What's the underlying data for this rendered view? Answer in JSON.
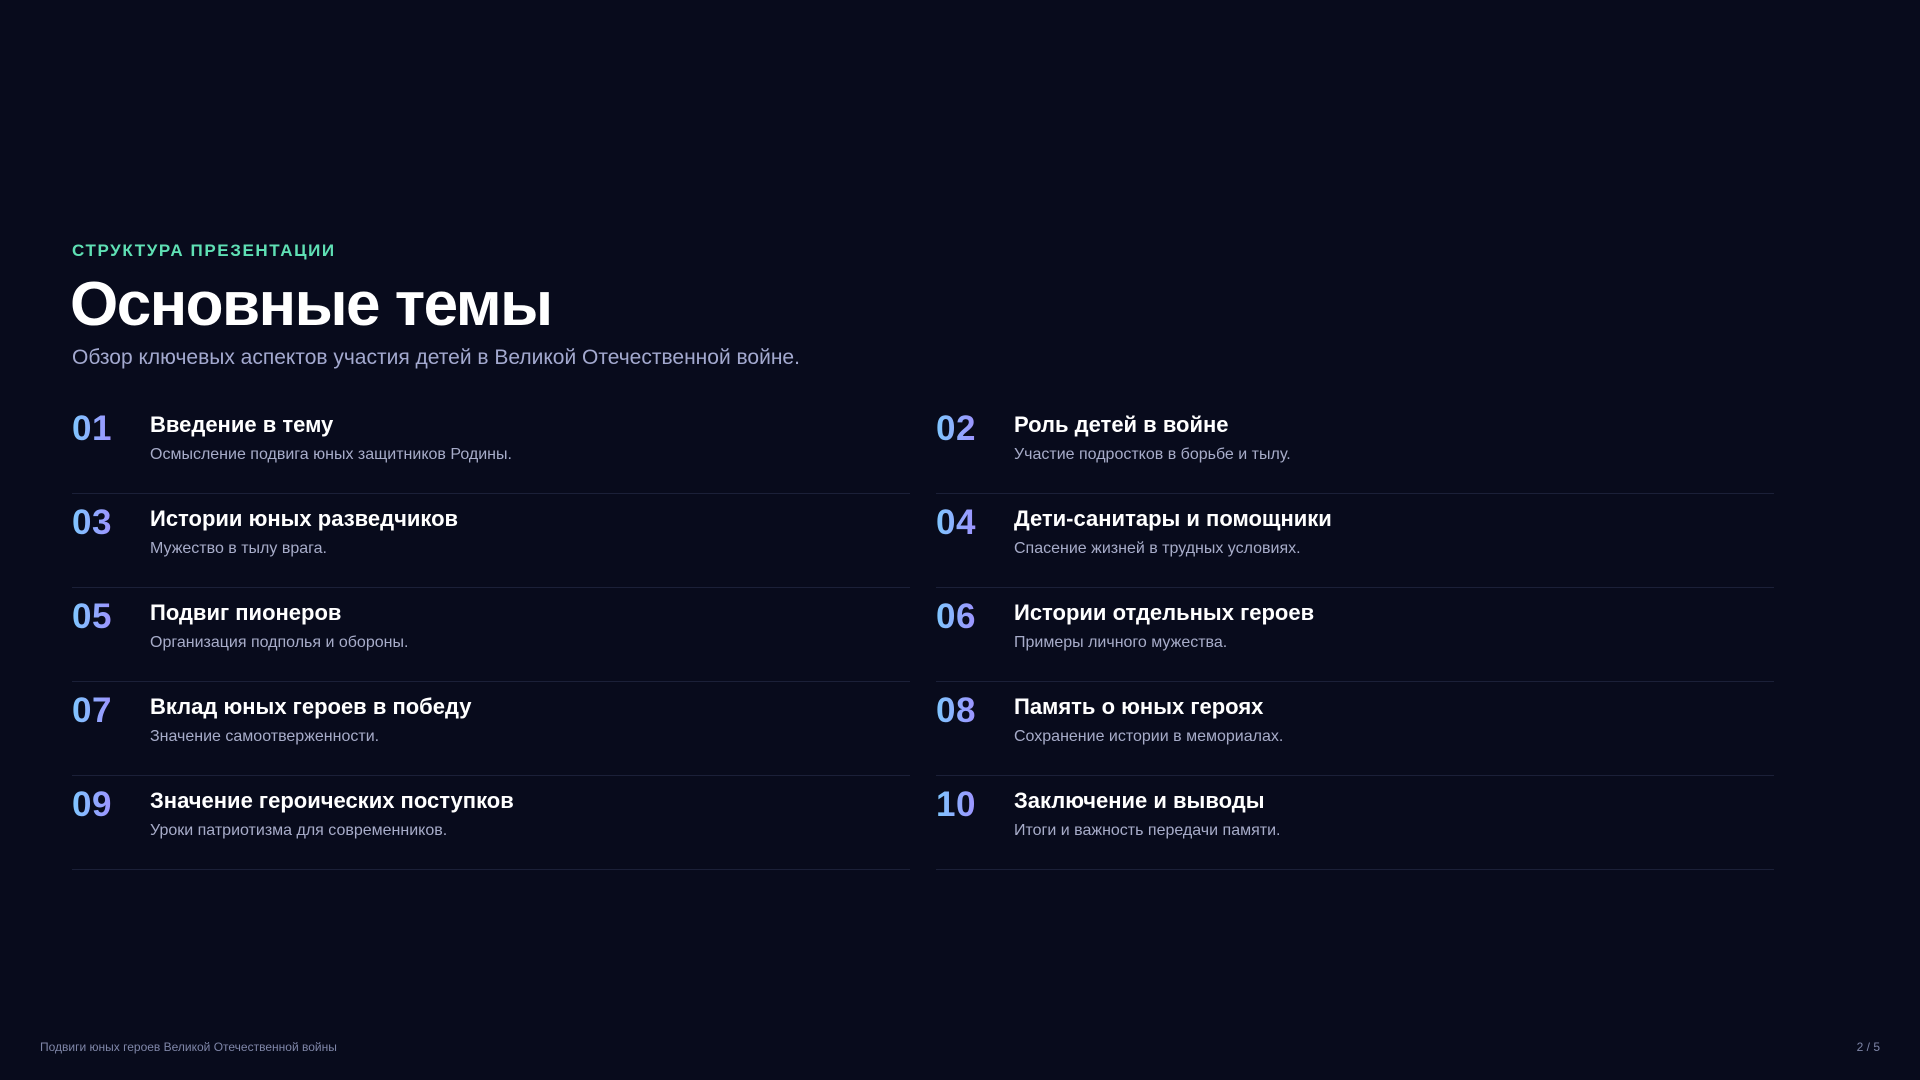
{
  "slide": {
    "eyebrow": "СТРУКТУРА ПРЕЗЕНТАЦИИ",
    "title": "Основные темы",
    "subtitle": "Обзор ключевых аспектов участия детей в Великой Отечественной войне."
  },
  "topics": [
    {
      "num": "01",
      "title": "Введение в тему",
      "desc": "Осмысление подвига юных защитников Родины."
    },
    {
      "num": "02",
      "title": "Роль детей в войне",
      "desc": "Участие подростков в борьбе и тылу."
    },
    {
      "num": "03",
      "title": "Истории юных разведчиков",
      "desc": "Мужество в тылу врага."
    },
    {
      "num": "04",
      "title": "Дети-санитары и помощники",
      "desc": "Спасение жизней в трудных условиях."
    },
    {
      "num": "05",
      "title": "Подвиг пионеров",
      "desc": "Организация подполья и обороны."
    },
    {
      "num": "06",
      "title": "Истории отдельных героев",
      "desc": "Примеры личного мужества."
    },
    {
      "num": "07",
      "title": "Вклад юных героев в победу",
      "desc": "Значение самоотверженности."
    },
    {
      "num": "08",
      "title": "Память о юных героях",
      "desc": "Сохранение истории в мемориалах."
    },
    {
      "num": "09",
      "title": "Значение героических поступков",
      "desc": "Уроки патриотизма для современников."
    },
    {
      "num": "10",
      "title": "Заключение и выводы",
      "desc": "Итоги и важность передачи памяти."
    }
  ],
  "footer": {
    "presentation_title": "Подвиги юных героев Великой Отечественной войны",
    "page_indicator": "2 / 5"
  },
  "colors": {
    "background": "#080b1c",
    "eyebrow_accent": "#5fe0b4",
    "number_gradient_start": "#7fc7ff",
    "number_gradient_end": "#9d93ff"
  }
}
